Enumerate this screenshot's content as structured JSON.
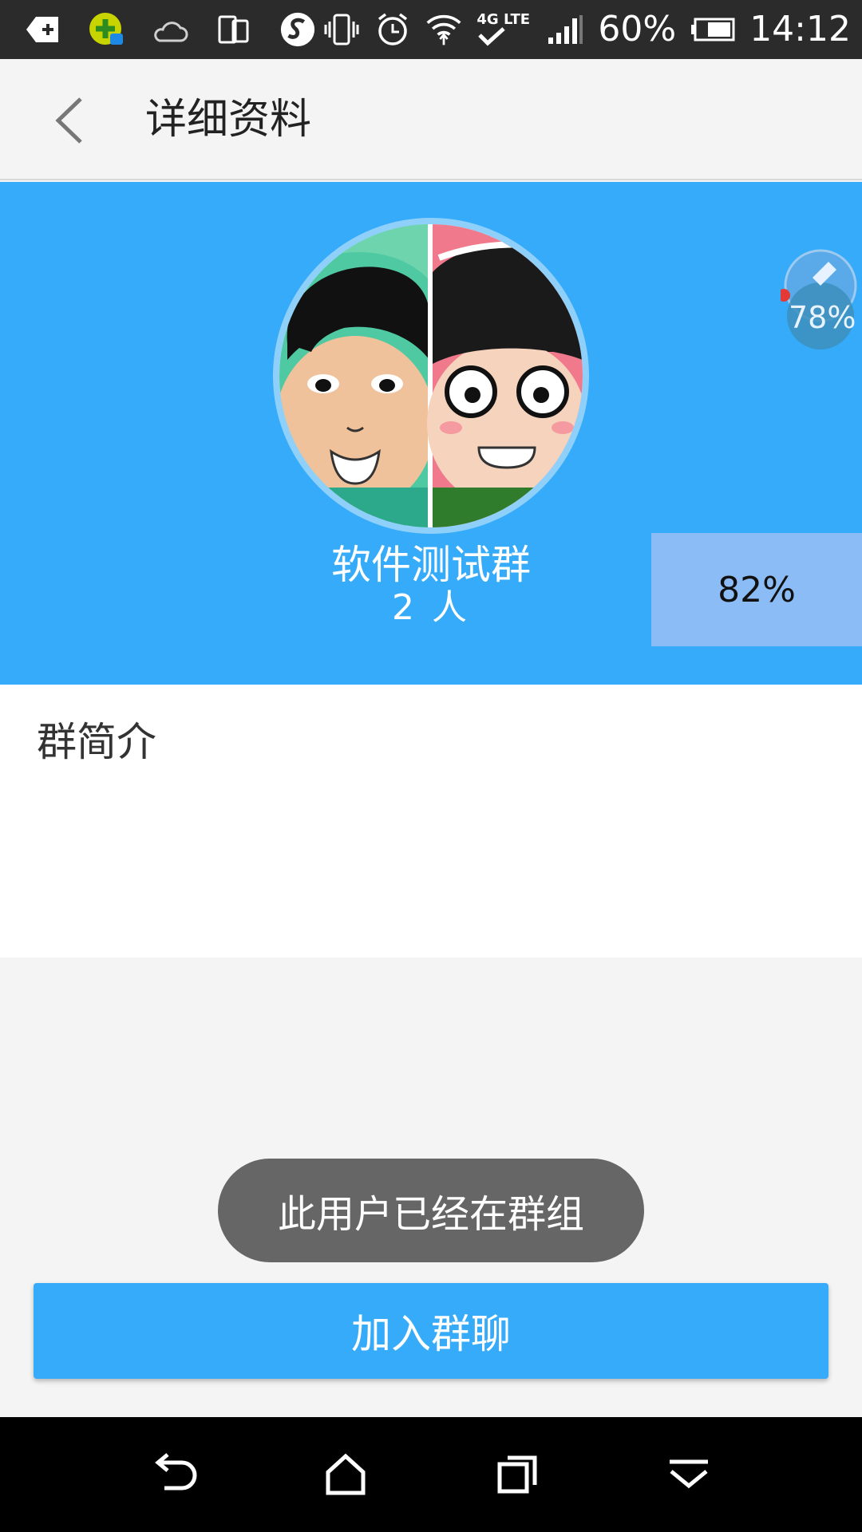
{
  "status_bar": {
    "battery_percent_label": "60%",
    "time": "14:12",
    "network_label": "4G LTE",
    "icons": [
      "app-notify-icon",
      "security-app-icon",
      "weather-icon",
      "phone-tablet-icon",
      "s-app-icon",
      "vibrate-icon",
      "alarm-icon",
      "wifi-icon",
      "signal-icon",
      "battery-icon"
    ]
  },
  "header": {
    "title": "详细资料",
    "back_icon": "chevron-left-icon"
  },
  "group": {
    "name": "软件测试群",
    "member_count": "2 人"
  },
  "overlay": {
    "percent_label": "82%"
  },
  "float_ball": {
    "percent_label": "78%"
  },
  "intro": {
    "title": "群简介"
  },
  "toast": {
    "text": "此用户已经在群组"
  },
  "join_button": {
    "label": "加入群聊"
  },
  "nav_bar": {
    "icons": [
      "back-icon",
      "home-icon",
      "recents-icon",
      "collapse-icon"
    ]
  },
  "colors": {
    "accent": "#36abfa",
    "status_bar": "#2b2b2b",
    "toast_bg": "#666666",
    "overlay_bg": "#8cbcf5"
  }
}
